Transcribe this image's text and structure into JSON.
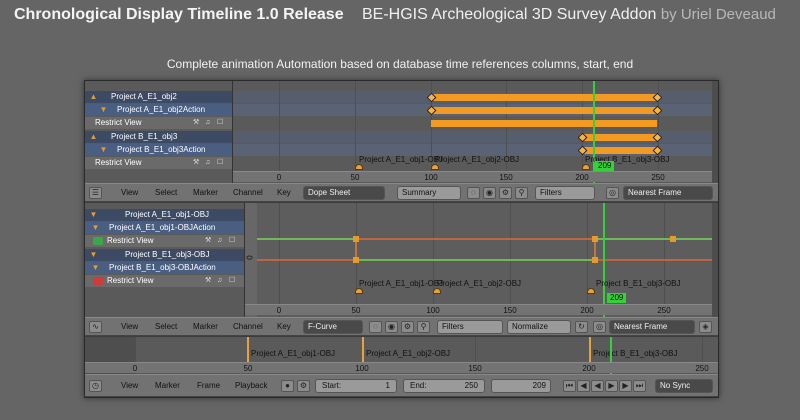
{
  "header": {
    "title": "Chronological Display Timeline 1.0 Release",
    "addon": "BE-HGIS Archeological 3D Survey Addon",
    "author": "by Uriel Deveaud"
  },
  "caption": "Complete animation Automation based on database time references columns, start, end",
  "dopesheet": {
    "channels": [
      {
        "label": "Project A_E1_obj2",
        "kind": "obj"
      },
      {
        "label": "Project A_E1_obj2Action",
        "kind": "act"
      },
      {
        "label": "Restrict View",
        "kind": "res"
      },
      {
        "label": "Project B_E1_obj3",
        "kind": "obj"
      },
      {
        "label": "Project B_E1_obj3Action",
        "kind": "act"
      },
      {
        "label": "Restrict View",
        "kind": "res"
      }
    ],
    "ruler_ticks": [
      "0",
      "50",
      "100",
      "150",
      "200",
      "250"
    ],
    "markers": [
      "Project A_E1_obj1-OBJ",
      "Project A_E1_obj2-OBJ",
      "Project B_E1_obj3-OBJ"
    ],
    "current_frame": "209",
    "toolbar": {
      "view": "View",
      "select": "Select",
      "marker": "Marker",
      "channel": "Channel",
      "key": "Key",
      "mode": "Dope Sheet",
      "summary": "Summary",
      "filters": "Filters",
      "snap": "Nearest Frame"
    }
  },
  "graph": {
    "channels": [
      {
        "label": "Project A_E1_obj1-OBJ",
        "kind": "obj"
      },
      {
        "label": "Project A_E1_obj1-OBJAction",
        "kind": "act"
      },
      {
        "label": "Restrict View",
        "kind": "res",
        "color": "#3aa84a"
      },
      {
        "label": "Project B_E1_obj3-OBJ",
        "kind": "obj"
      },
      {
        "label": "Project B_E1_obj3-OBJAction",
        "kind": "act"
      },
      {
        "label": "Restrict View",
        "kind": "res",
        "color": "#d23a3a"
      }
    ],
    "y_label": "0",
    "ruler_ticks": [
      "0",
      "50",
      "100",
      "150",
      "200",
      "250"
    ],
    "markers": [
      "Project A_E1_obj1-OBJ",
      "Project A_E1_obj2-OBJ",
      "Project B_E1_obj3-OBJ"
    ],
    "current_frame": "209",
    "toolbar": {
      "view": "View",
      "select": "Select",
      "marker": "Marker",
      "channel": "Channel",
      "key": "Key",
      "mode": "F-Curve",
      "filters": "Filters",
      "normalize": "Normalize",
      "snap": "Nearest Frame"
    }
  },
  "timeline": {
    "ruler_ticks": [
      "0",
      "50",
      "100",
      "150",
      "200",
      "250"
    ],
    "markers": [
      "Project A_E1_obj1-OBJ",
      "Project A_E1_obj2-OBJ",
      "Project B_E1_obj3-OBJ"
    ],
    "toolbar": {
      "view": "View",
      "marker": "Marker",
      "frame": "Frame",
      "playback": "Playback",
      "start_label": "Start:",
      "start_value": "1",
      "end_label": "End:",
      "end_value": "250",
      "current": "209",
      "sync": "No Sync"
    }
  },
  "colors": {
    "accent_green": "#36d03a",
    "key_bar": "#f39a22",
    "channel_obj": "#3c4a63",
    "channel_action": "#4a5e82"
  },
  "icons": [
    "dopesheet-editor-icon",
    "graph-editor-icon",
    "timeline-editor-icon",
    "play-icon",
    "record-icon",
    "key-icon",
    "filter-icon"
  ]
}
